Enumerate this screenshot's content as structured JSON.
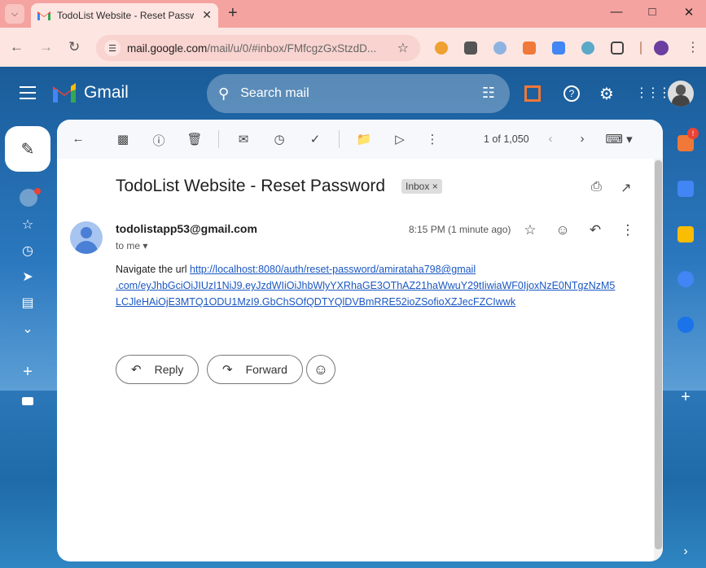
{
  "browser": {
    "tab_title": "TodoList Website - Reset Password",
    "tab_title_visible": "TodoList Website - Reset Passw",
    "url_host": "mail.google.com",
    "url_path": "/mail/u/0/#inbox/FMfcgzGxStzdD..."
  },
  "gmail": {
    "brand": "Gmail",
    "search_placeholder": "Search mail"
  },
  "toolbar": {
    "pager": "1 of 1,050"
  },
  "message": {
    "subject": "TodoList Website - Reset Password",
    "label_chip": "Inbox",
    "sender": "todolistapp53@gmail.com",
    "recipient": "to me",
    "time": "8:15 PM (1 minute ago)",
    "body_prefix": "Navigate the url ",
    "link_line1": "http://localhost:8080/auth/reset-password/amirataha798@gmail",
    "link_line2": ".com/eyJhbGciOiJIUzI1NiJ9.eyJzdWIiOiJhbWlyYXRhaGE3OThAZ21haWwuY29tIiwiaWF0IjoxNzE0NTgzNzM5",
    "link_line3": "LCJleHAiOjE3MTQ1ODU1MzI9.GbChSOfQDTYQlDVBmRRE52ioZSofioXZJecFZCIwwk"
  },
  "actions": {
    "reply": "Reply",
    "forward": "Forward"
  },
  "badges": {
    "side_notification": "!"
  },
  "colors": {
    "tab_strip": "#f4a3a0",
    "toolbar_bg": "#fde5e2",
    "link": "#1a57c2",
    "gmail_red": "#ea4335"
  }
}
